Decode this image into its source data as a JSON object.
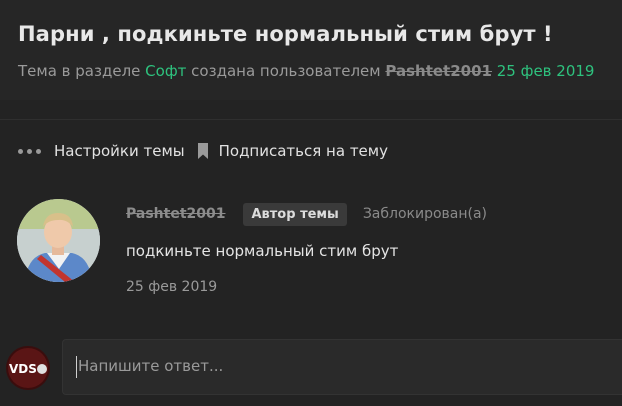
{
  "topic": {
    "title": "Парни , подкиньте нормальный стим брут !",
    "meta_prefix": "Тема в разделе",
    "section": "Софт",
    "meta_mid": "создана пользователем",
    "author": "Pashtet2001",
    "date": "25 фев 2019",
    "link_color": "#2ec27e"
  },
  "toolbar": {
    "settings_label": "Настройки темы",
    "subscribe_label": "Подписаться на тему",
    "settings_icon": "more-dots-icon",
    "subscribe_icon": "bookmark-icon"
  },
  "post": {
    "author": "Pashtet2001",
    "badge": "Автор темы",
    "status": "Заблокирован(а)",
    "text": "подкиньте нормальный стим брут",
    "date": "25 фев 2019"
  },
  "reply": {
    "placeholder": "Напишите ответ...",
    "avatar_logo": "VDS"
  }
}
